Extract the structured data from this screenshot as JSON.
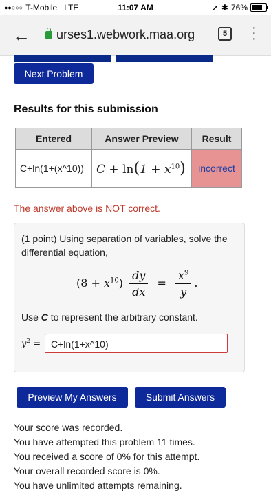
{
  "status_bar": {
    "carrier": "T-Mobile",
    "network": "LTE",
    "time": "11:07 AM",
    "battery": "76%"
  },
  "browser": {
    "url": "urses1.webwork.maa.org",
    "tab_count": "5"
  },
  "nav": {
    "next_problem": "Next Problem"
  },
  "results": {
    "title": "Results for this submission",
    "columns": [
      "Entered",
      "Answer Preview",
      "Result"
    ],
    "entered": "C+ln(1+(x^10))",
    "result": "incorrect"
  },
  "feedback": {
    "message": "The answer above is NOT correct."
  },
  "problem": {
    "statement": "(1 point) Using separation of variables, solve the differential equation,",
    "instruction_prefix": "Use ",
    "instruction_var": "C",
    "instruction_suffix": " to represent the arbitrary constant.",
    "answer_value": "C+ln(1+x^10)"
  },
  "buttons": {
    "preview": "Preview My Answers",
    "submit": "Submit Answers"
  },
  "score": {
    "lines": [
      "Your score was recorded.",
      "You have attempted this problem 11 times.",
      "You received a score of 0% for this attempt.",
      "Your overall recorded score is 0%.",
      "You have unlimited attempts remaining."
    ]
  }
}
